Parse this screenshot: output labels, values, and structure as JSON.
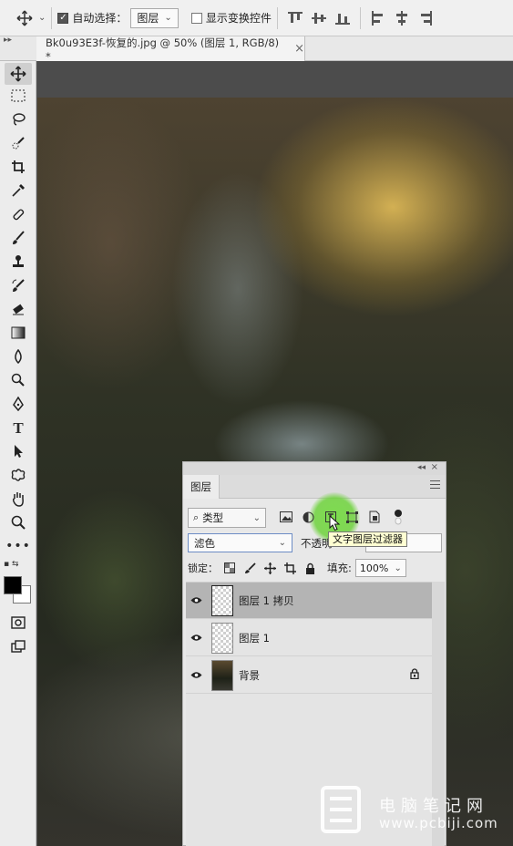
{
  "options_bar": {
    "auto_select_label": "自动选择：",
    "auto_select_checked": true,
    "auto_select_target": "图层",
    "show_transform_label": "显示变换控件",
    "show_transform_checked": false
  },
  "document": {
    "tab_title": "Bk0u93E3f-恢复的.jpg @ 50% (图层 1, RGB/8) *",
    "close_glyph": "×"
  },
  "toolbar": {
    "tools": [
      "move-tool-icon",
      "marquee-tool-icon",
      "lasso-tool-icon",
      "quick-select-tool-icon",
      "crop-tool-icon",
      "eyedropper-tool-icon",
      "healing-brush-icon",
      "brush-tool-icon",
      "clone-stamp-icon",
      "history-brush-icon",
      "eraser-tool-icon",
      "gradient-tool-icon",
      "blur-tool-icon",
      "dodge-tool-icon",
      "pen-tool-icon",
      "type-tool-icon",
      "path-select-icon",
      "custom-shape-icon",
      "hand-tool-icon",
      "zoom-tool-icon",
      "more-tools-icon"
    ],
    "foreground_color": "#000000",
    "background_color": "#ffffff"
  },
  "layers_panel": {
    "tab_label": "图层",
    "filter_kind": "类型",
    "filter_icons": [
      "pixel-filter-icon",
      "adjustment-filter-icon",
      "type-filter-icon",
      "shape-filter-icon",
      "smart-object-filter-icon",
      "filter-toggle-icon"
    ],
    "tooltip": "文字图层过滤器",
    "blend_mode": "滤色",
    "opacity_label": "不透明",
    "lock_label": "锁定：",
    "fill_label": "填充:",
    "fill_value": "100%",
    "layers": [
      {
        "name": "图层 1 拷贝",
        "visible": true,
        "selected": true,
        "locked": false
      },
      {
        "name": "图层 1",
        "visible": true,
        "selected": false,
        "locked": false
      },
      {
        "name": "背景",
        "visible": true,
        "selected": false,
        "locked": true
      }
    ]
  },
  "watermark": {
    "title": "电脑笔记网",
    "url": "www.pcbiji.com"
  },
  "colors": {
    "selected_layer": "#b4b4b4",
    "tooltip_bg": "#ffffd2",
    "cursor_highlight": "#78dc46"
  }
}
